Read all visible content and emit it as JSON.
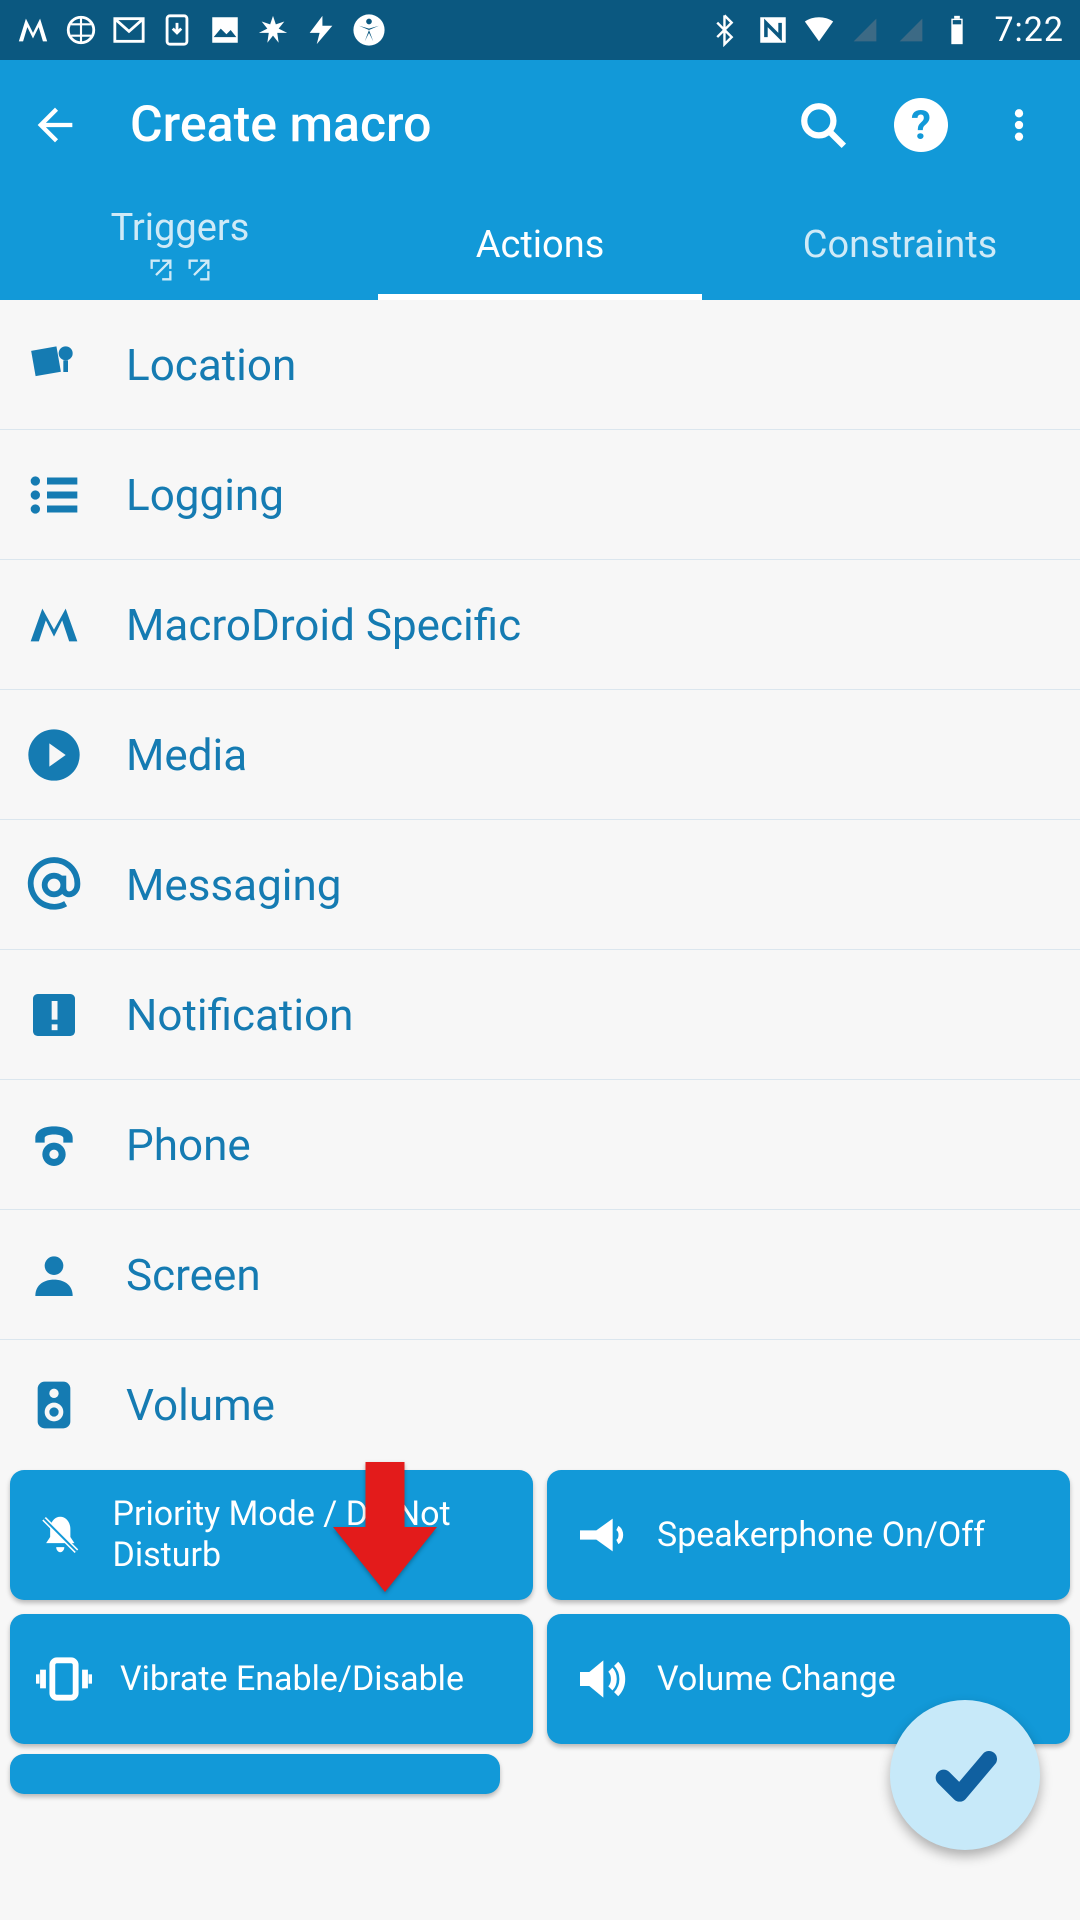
{
  "statusbar": {
    "time": "7:22"
  },
  "header": {
    "title": "Create macro",
    "tabs": {
      "triggers": "Triggers",
      "actions": "Actions",
      "constraints": "Constraints"
    }
  },
  "categories": [
    {
      "label": "Location"
    },
    {
      "label": "Logging"
    },
    {
      "label": "MacroDroid Specific"
    },
    {
      "label": "Media"
    },
    {
      "label": "Messaging"
    },
    {
      "label": "Notification"
    },
    {
      "label": "Phone"
    },
    {
      "label": "Screen"
    },
    {
      "label": "Volume"
    }
  ],
  "volume_actions": {
    "priority": "Priority Mode / Do Not Disturb",
    "speaker": "Speakerphone On/Off",
    "vibrate": "Vibrate Enable/Disable",
    "volume": "Volume Change"
  },
  "colors": {
    "accent": "#1299d8",
    "statusbar": "#0b5880",
    "text": "#157bb2"
  }
}
